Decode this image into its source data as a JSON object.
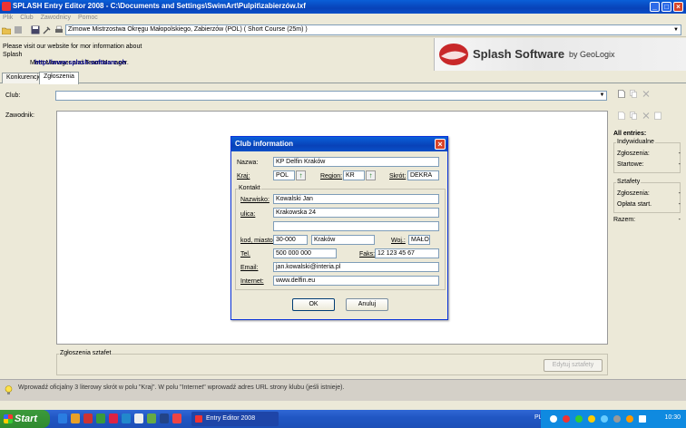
{
  "window": {
    "title": "SPLASH Entry Editor 2008 - C:\\Documents and Settings\\SwimArt\\Pulpit\\zabierzów.lxf",
    "minimize": "_",
    "maximize": "□",
    "close": "×"
  },
  "menu": [
    "Plik",
    "Club",
    "Zawodnicy",
    "Pomoc"
  ],
  "toolbar": {
    "meet": "Zimowe Mistrzostwa Okręgu Małopolskiego,  Zabierzów  (POL)  ( Short Course (25m) )"
  },
  "info": {
    "line1": "Please visit our website for mor information about Splash",
    "line2": "Meet Manager and Team Manager.",
    "link": "http://www.splash-software.ch"
  },
  "banner": {
    "brand": "Splash Software",
    "by": "by GeoLogix"
  },
  "tabs": [
    {
      "label": "Konkurencje",
      "active": false
    },
    {
      "label": "Zgłoszenia",
      "active": true
    }
  ],
  "main": {
    "club_label": "Club:",
    "club_value": "",
    "swimmer_label": "Zawodnik:",
    "relays_group": "Zgłoszenia sztafet",
    "edit_relays": "Edytuj sztafety"
  },
  "right_panel": {
    "all_entries": "All entries:",
    "individual": "Indywidualne",
    "individual_rows": [
      {
        "label": "Zgłoszenia:",
        "value": "-"
      },
      {
        "label": "Startowe:",
        "value": "-"
      }
    ],
    "relays": "Sztafety",
    "relay_rows": [
      {
        "label": "Zgłoszenia:",
        "value": "-"
      },
      {
        "label": "Opłata start.",
        "value": "-"
      }
    ],
    "total_label": "Razem:",
    "total_value": "-"
  },
  "dialog": {
    "title": "Club information",
    "name_label": "Nazwa:",
    "name": "KP Delfin Kraków",
    "country_label": "Kraj:",
    "country": "POL",
    "region_label": "Region:",
    "region": "KR",
    "short_label": "Skrót:",
    "short": "DEKRA",
    "contact_group": "Kontakt",
    "surname_label": "Nazwisko:",
    "surname": "Kowalski Jan",
    "street_label": "ulica:",
    "street": "Krakowska 24",
    "street2": "",
    "postal_label": "kod, miasto:",
    "postal": "30-000",
    "city": "Kraków",
    "voivodeship_label": "Woj.:",
    "voivodeship": "MAŁO",
    "phone_label": "Tel.",
    "phone": "500 000 000",
    "fax_label": "Faks:",
    "fax": "12 123 45 67",
    "email_label": "Email:",
    "email": "jan.kowalski@interia.pl",
    "web_label": "Internet:",
    "web": "www.delfin.eu",
    "ok": "OK",
    "cancel": "Anuluj"
  },
  "status": {
    "text": "Wprowadź oficjalny 3 literowy skrót w polu \"Kraj\". W polu \"Internet\" wprowadź adres URL strony klubu (jeśli istnieje)."
  },
  "taskbar": {
    "start": "Start",
    "task": "Entry Editor 2008",
    "lang": "PL",
    "clock": "10:30"
  },
  "colors": {
    "titlebar": "#0842b8",
    "dialog_border": "#0831d9",
    "link": "#00008b",
    "start": "#2f8a2f"
  }
}
